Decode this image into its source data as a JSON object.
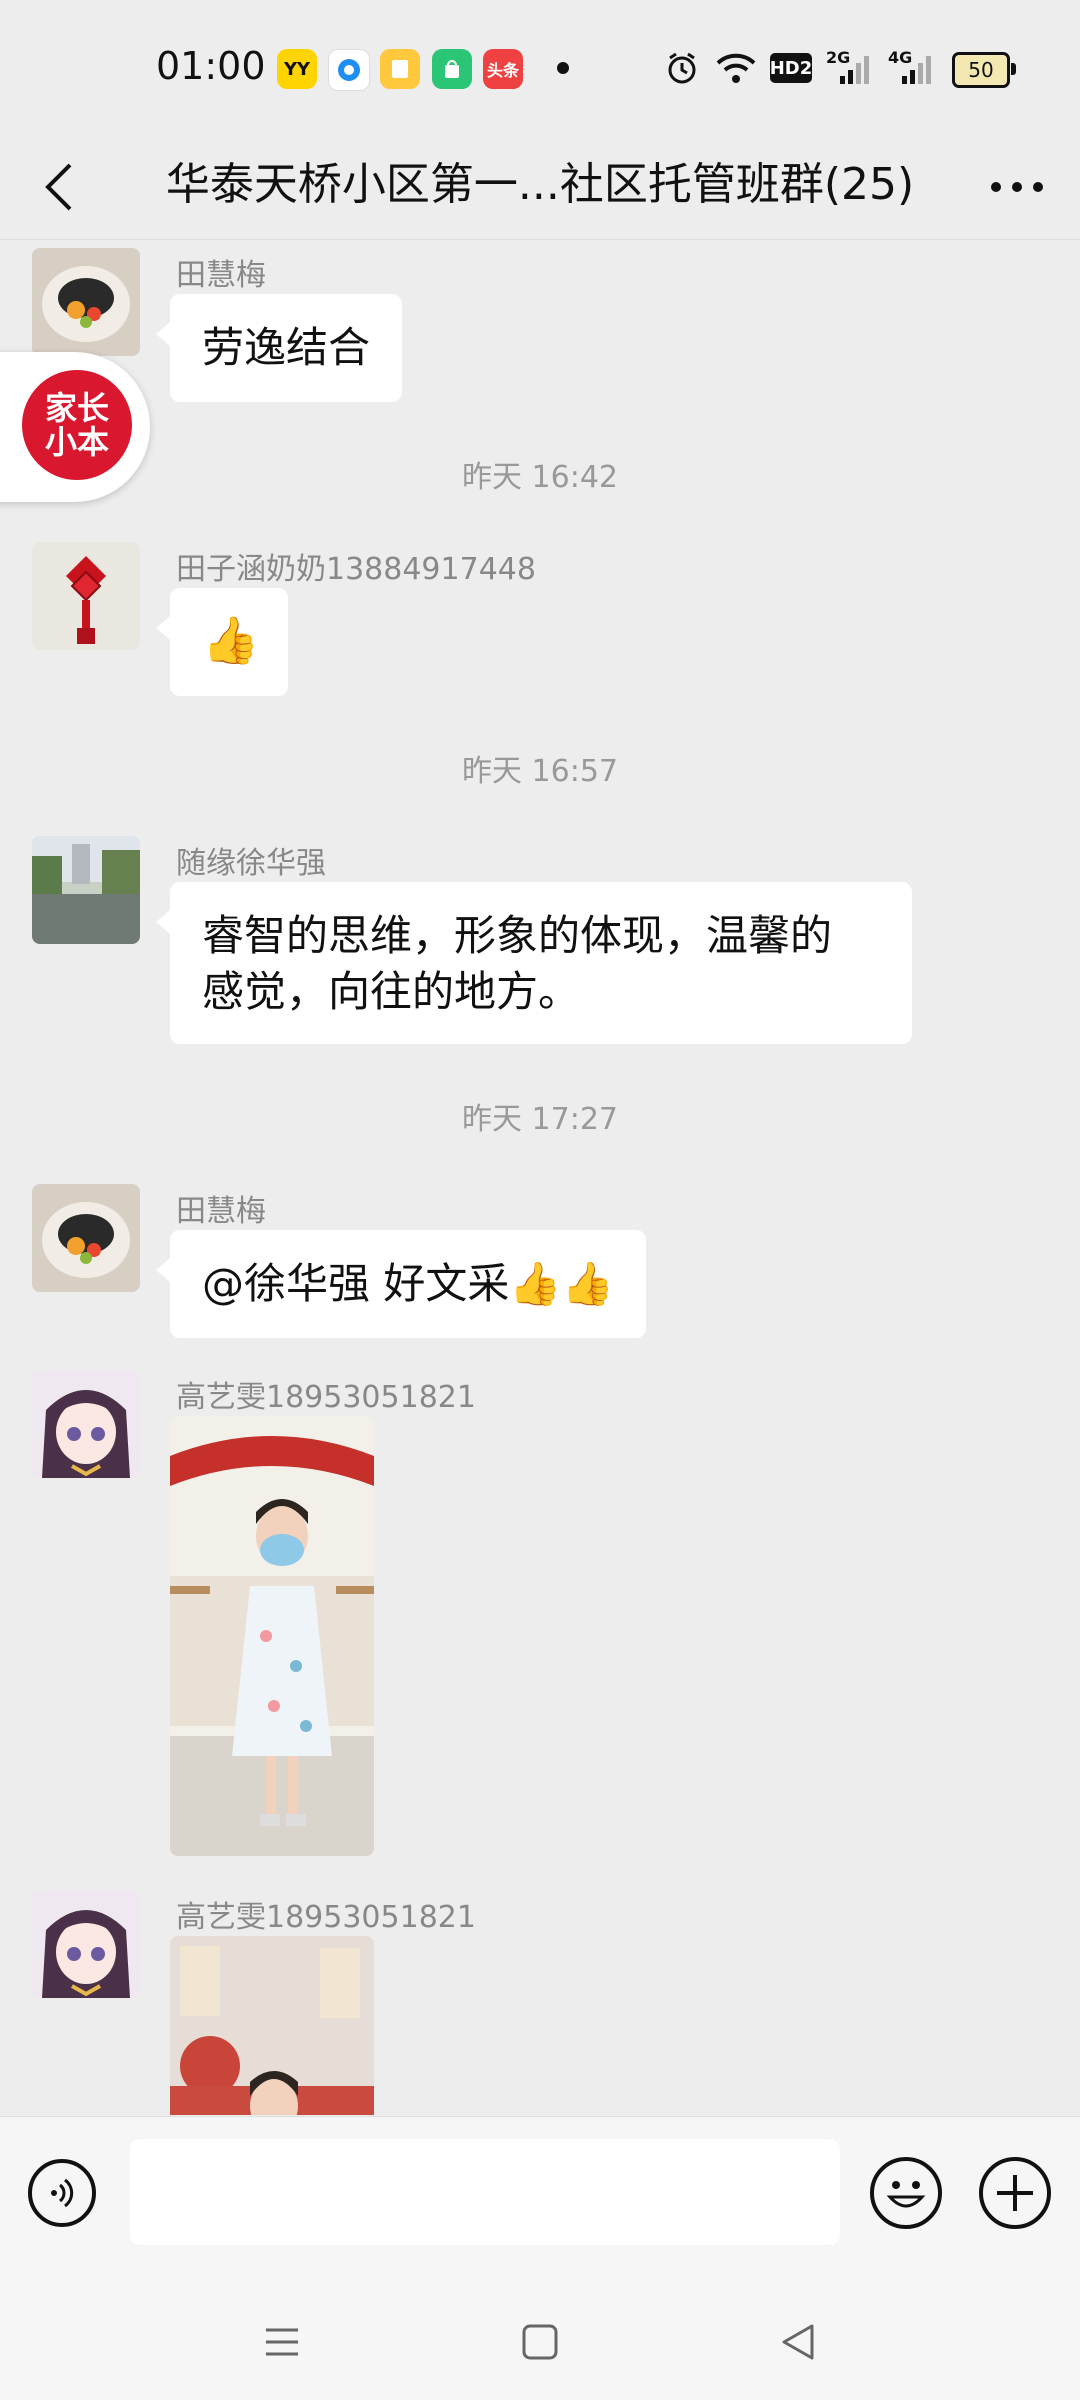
{
  "status_bar": {
    "time": "01:00",
    "notifications": [
      {
        "label": "YY",
        "color": "#ffd400"
      },
      {
        "label": "",
        "color": "#ffffff"
      },
      {
        "label": "",
        "color": "#ffc83d"
      },
      {
        "label": "",
        "color": "#2bc675"
      },
      {
        "label": "头条",
        "color": "#f04142"
      }
    ],
    "hd_label": "HD2",
    "net1_label": "2G",
    "net2_label": "4G",
    "battery": "50"
  },
  "header": {
    "title": "华泰天桥小区第一...社区托管班群(25)"
  },
  "floating_badge": {
    "line1": "家长",
    "line2": "小本"
  },
  "messages": [
    {
      "sender": "田慧梅",
      "text": "劳逸结合"
    },
    {
      "timestamp": "昨天 16:42"
    },
    {
      "sender": "田子涵奶奶13884917448",
      "text": "👍"
    },
    {
      "timestamp": "昨天 16:57"
    },
    {
      "sender": "随缘徐华强",
      "text_line1": "睿智的思维，形象的体现，温馨的",
      "text_line2": "感觉，向往的地方。"
    },
    {
      "timestamp": "昨天 17:27"
    },
    {
      "sender": "田慧梅",
      "text": "@徐华强  好文采👍👍"
    },
    {
      "sender": "高艺雯18953051821",
      "photo": "girl-in-mask-photo"
    },
    {
      "sender": "高艺雯18953051821",
      "photo": "girl-photo-partial"
    }
  ],
  "colors": {
    "background": "#ededed",
    "bubble": "#ffffff",
    "timestamp": "#999999",
    "badge_red": "#d9172e"
  }
}
